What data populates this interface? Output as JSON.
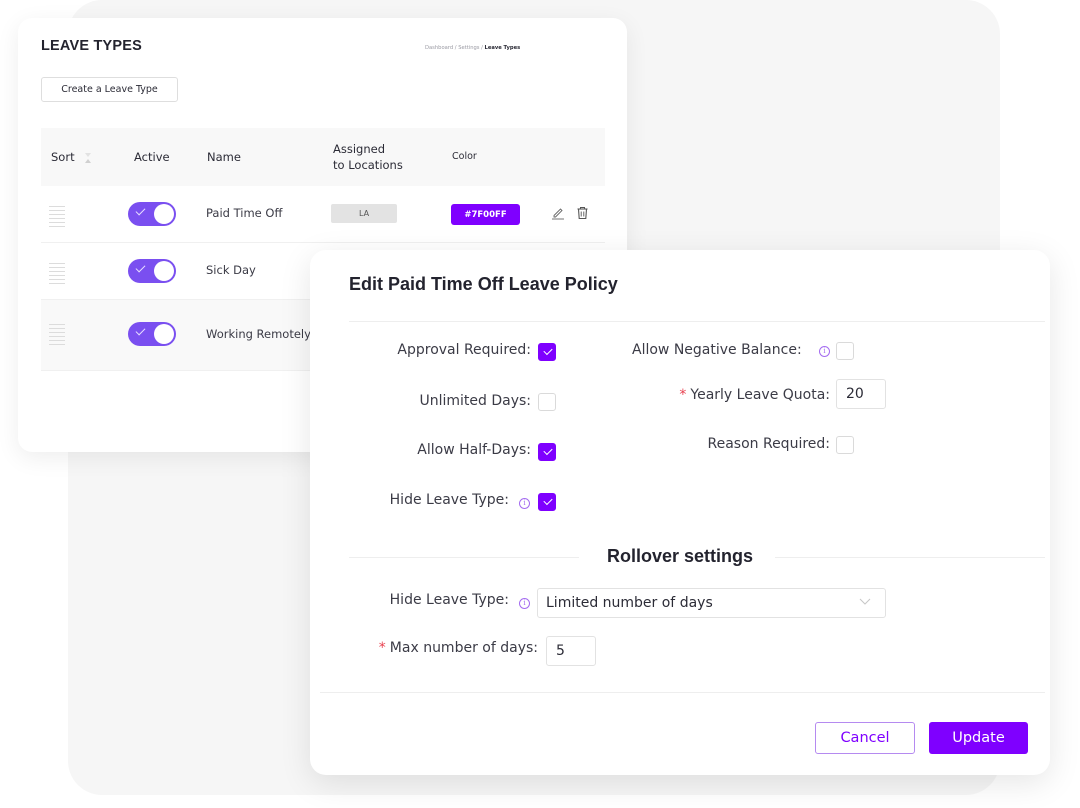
{
  "leave_types": {
    "title": "LEAVE TYPES",
    "breadcrumb": [
      "Dashboard",
      "Settings",
      "Leave Types"
    ],
    "breadcrumb_separator": " / ",
    "create_button": "Create a Leave Type",
    "columns": {
      "sort": "Sort",
      "active": "Active",
      "name": "Name",
      "assigned_line1": "Assigned",
      "assigned_line2": "to Locations",
      "color": "Color"
    },
    "rows": [
      {
        "name": "Paid Time Off",
        "active": true,
        "location": "LA",
        "color": "#7F00FF"
      },
      {
        "name": "Sick Day",
        "active": true
      },
      {
        "name": "Working Remotely",
        "active": true
      }
    ]
  },
  "modal": {
    "title": "Edit Paid Time Off Leave Policy",
    "fields": {
      "approval_required": {
        "label": "Approval Required:",
        "checked": true
      },
      "unlimited_days": {
        "label": "Unlimited Days:",
        "checked": false
      },
      "allow_half_days": {
        "label": "Allow Half-Days:",
        "checked": true
      },
      "hide_leave_type": {
        "label": "Hide Leave Type:",
        "checked": true
      },
      "allow_negative_balance": {
        "label": "Allow Negative Balance:",
        "checked": false
      },
      "yearly_leave_quota": {
        "label": "Yearly Leave Quota:",
        "value": "20",
        "required": true
      },
      "reason_required": {
        "label": "Reason Required:",
        "checked": false
      }
    },
    "rollover": {
      "title": "Rollover settings",
      "type_label": "Hide Leave Type:",
      "type_value": "Limited number of days",
      "max_days_label": "Max number of days:",
      "max_days_value": "5"
    },
    "required_marker": "*",
    "info_glyph": "i",
    "cancel_label": "Cancel",
    "update_label": "Update"
  },
  "colors": {
    "accent": "#7F00FF",
    "toggle": "#7A4FF0",
    "required": "#E8414F"
  }
}
